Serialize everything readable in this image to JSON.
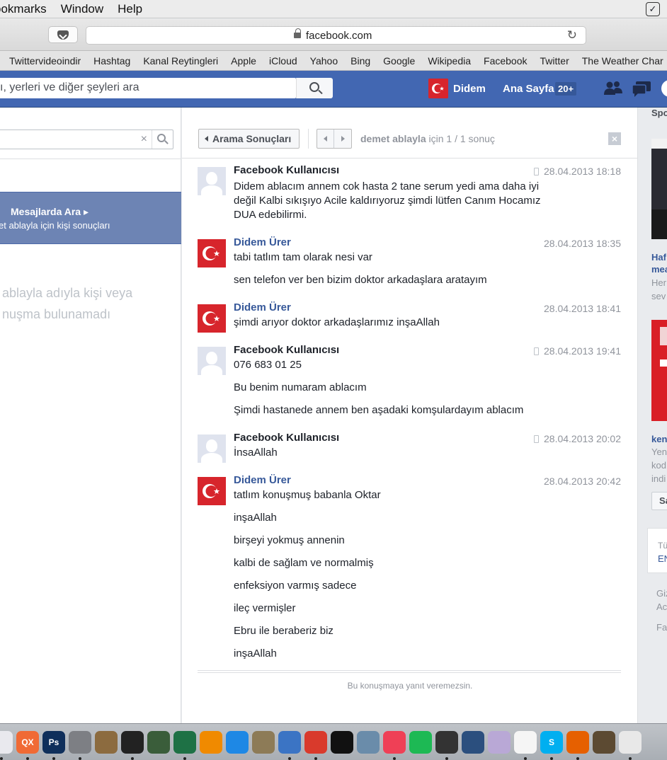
{
  "menubar": {
    "items": [
      "ookmarks",
      "Window",
      "Help"
    ]
  },
  "toolbar": {
    "url": "facebook.com"
  },
  "favorites": [
    "Twittervideoindir",
    "Hashtag",
    "Kanal Reytingleri",
    "Apple",
    "iCloud",
    "Yahoo",
    "Bing",
    "Google",
    "Wikipedia",
    "Facebook",
    "Twitter",
    "The Weather Char"
  ],
  "fbbar": {
    "search_placeholder": "ı, yerleri ve diğer şeyleri ara",
    "user_name": "Didem",
    "home_label": "Ana Sayfa",
    "home_badge": "20+"
  },
  "left": {
    "search_clear": "×",
    "msg_search_title": "Mesajlarda Ara ▸",
    "msg_search_sub": "et ablayla için kişi sonuçları",
    "no_result_1": "ablayla adıyla kişi veya",
    "no_result_2": "nuşma bulunamadı"
  },
  "main": {
    "back_label": "Arama Sonuçları",
    "result_query": "demet ablayla",
    "result_suffix": " için 1 / 1 sonuç",
    "close_label": "×",
    "footer_note": "Bu konuşmaya yanıt veremezsin."
  },
  "messages": [
    {
      "sender": "Facebook Kullanıcısı",
      "avatar": "default",
      "mobile": true,
      "time": "28.04.2013 18:18",
      "lines": [
        "Didem ablacım annem cok hasta 2 tane serum yedi ama daha iyi",
        "değil Kalbi sıkışıyo Acile kaldırıyoruz  şimdi lütfen Canım Hocamız",
        "DUA edebilirmi."
      ]
    },
    {
      "sender": "Didem Ürer",
      "avatar": "flag",
      "mobile": false,
      "time": "28.04.2013 18:35",
      "lines": [
        "tabi tatlım tam olarak nesi var",
        "sen telefon ver ben bizim doktor arkadaşlara aratayım"
      ]
    },
    {
      "sender": "Didem Ürer",
      "avatar": "flag",
      "mobile": false,
      "time": "28.04.2013 18:41",
      "lines": [
        "şimdi arıyor doktor arkadaşlarımız inşaAllah"
      ]
    },
    {
      "sender": "Facebook Kullanıcısı",
      "avatar": "default",
      "mobile": true,
      "time": "28.04.2013 19:41",
      "lines": [
        "076 683 01 25",
        "Bu benim numaram ablacım",
        "Şimdi hastanede annem ben aşadaki komşulardayım ablacım"
      ]
    },
    {
      "sender": "Facebook Kullanıcısı",
      "avatar": "default",
      "mobile": true,
      "time": "28.04.2013 20:02",
      "lines": [
        "İnsaAllah"
      ]
    },
    {
      "sender": "Didem Ürer",
      "avatar": "flag",
      "mobile": false,
      "time": "28.04.2013 20:42",
      "lines": [
        "tatlım konuşmuş babanla Oktar",
        "inşaAllah",
        "birşeyi yokmuş annenin",
        "kalbi de sağlam ve normalmiş",
        "enfeksiyon varmış sadece",
        "ileç vermişler",
        "Ebru ile beraberiz biz",
        "inşaAllah"
      ]
    }
  ],
  "right": {
    "sponsored": "Spo",
    "ad1_title_1": "Haf",
    "ad1_title_2": "mea",
    "ad1_body_1": "Her",
    "ad1_body_2": "sev",
    "ad2_title": "ken",
    "ad2_body_1": "Yen",
    "ad2_body_2": "kod",
    "ad2_body_3": "indi",
    "ad2_btn": "Sa",
    "lang_1": "Tü",
    "lang_2": "EN",
    "foot_1": "Giz",
    "foot_2": "Ac",
    "foot_3": "Fa"
  },
  "dock": {
    "icons": [
      "music-icon",
      "qx-icon",
      "photoshop-icon",
      "system-prefs-icon",
      "package-icon",
      "activity-monitor-icon",
      "photo-icon",
      "excel-icon",
      "vlc-icon",
      "app-icon",
      "gimp-icon",
      "steam-icon",
      "pdf-icon",
      "terminal-icon",
      "preview-icon",
      "pocket-icon",
      "spotify-icon",
      "youtube-icon",
      "quicktime-icon",
      "ribbon-icon",
      "notes-icon",
      "skype-icon",
      "firefox-icon",
      "bin-icon",
      "textedit-icon"
    ],
    "ps_label": "Ps",
    "qx_label": "QX",
    "s_label": "S"
  }
}
